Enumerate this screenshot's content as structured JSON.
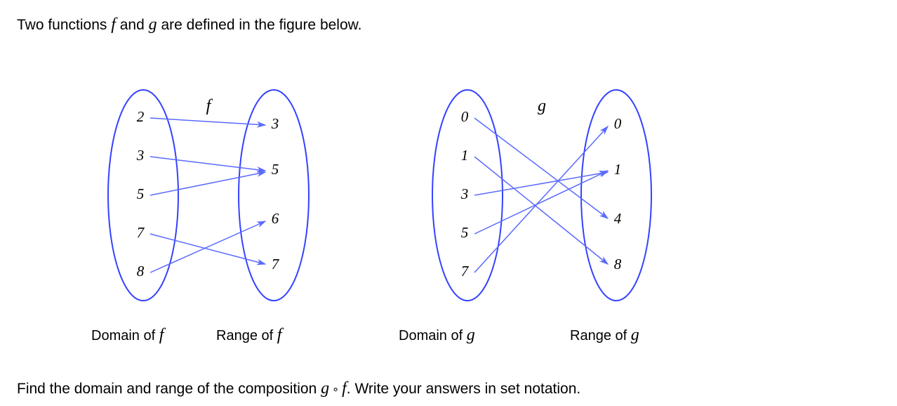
{
  "text": {
    "line1_a": "Two functions ",
    "line1_b": " and ",
    "line1_c": " are defined in the figure below.",
    "line2_a": "Find the domain and range of the composition ",
    "line2_b": ". Write your answers in set notation.",
    "f": "f",
    "g": "g",
    "compose": " ∘ "
  },
  "captions": {
    "df_a": "Domain of  ",
    "rf_a": "Range of  ",
    "dg_a": "Domain of  ",
    "rg_a": "Range of  "
  },
  "chart_data": [
    {
      "type": "mapping-diagram",
      "name": "f",
      "domain": [
        "2",
        "3",
        "5",
        "7",
        "8"
      ],
      "codomain": [
        "3",
        "5",
        "6",
        "7"
      ],
      "edges": [
        {
          "from": "2",
          "to": "3"
        },
        {
          "from": "3",
          "to": "5"
        },
        {
          "from": "5",
          "to": "5"
        },
        {
          "from": "7",
          "to": "7"
        },
        {
          "from": "8",
          "to": "6"
        }
      ],
      "domain_label": "Domain of f",
      "range_label": "Range of f"
    },
    {
      "type": "mapping-diagram",
      "name": "g",
      "domain": [
        "0",
        "1",
        "3",
        "5",
        "7"
      ],
      "codomain": [
        "0",
        "1",
        "4",
        "8"
      ],
      "edges": [
        {
          "from": "0",
          "to": "4"
        },
        {
          "from": "1",
          "to": "8"
        },
        {
          "from": "3",
          "to": "1"
        },
        {
          "from": "5",
          "to": "1"
        },
        {
          "from": "7",
          "to": "0"
        }
      ],
      "domain_label": "Domain of g",
      "range_label": "Range of g"
    }
  ],
  "diagram_numbers": {
    "f_dom_0": "2",
    "f_dom_1": "3",
    "f_dom_2": "5",
    "f_dom_3": "7",
    "f_dom_4": "8",
    "f_cod_0": "3",
    "f_cod_1": "5",
    "f_cod_2": "6",
    "f_cod_3": "7",
    "g_dom_0": "0",
    "g_dom_1": "1",
    "g_dom_2": "3",
    "g_dom_3": "5",
    "g_dom_4": "7",
    "g_cod_0": "0",
    "g_cod_1": "1",
    "g_cod_2": "4",
    "g_cod_3": "8"
  }
}
